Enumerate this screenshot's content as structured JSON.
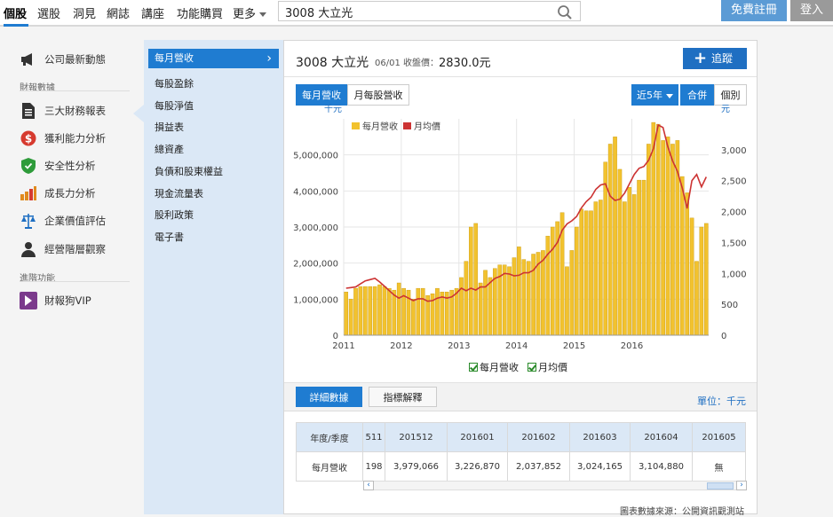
{
  "nav": {
    "items": [
      "個股",
      "選股",
      "洞見",
      "網誌",
      "講座",
      "功能購買",
      "更多"
    ],
    "search_value": "3008 大立光",
    "register": "免費註冊",
    "login": "登入"
  },
  "sidebar": {
    "top_item": "公司最新動態",
    "section1": "財報數據",
    "items": [
      "三大財務報表",
      "獲利能力分析",
      "安全性分析",
      "成長力分析",
      "企業價值評估",
      "經營階層觀察"
    ],
    "section2": "進階功能",
    "vip": "財報狗VIP"
  },
  "submenu": {
    "active": "每月營收",
    "items": [
      "每股盈餘",
      "每股淨值",
      "損益表",
      "總資產",
      "負債和股東權益",
      "現金流量表",
      "股利政策",
      "電子書"
    ]
  },
  "main": {
    "title": "3008 大立光",
    "date_label": "06/01 收盤價：",
    "price": "2830.0元",
    "track_button": "追蹤",
    "tab1": "每月營收",
    "tab2": "月每股營收",
    "range_button": "近5年",
    "merge_button": "合併",
    "single_button": "個別",
    "legend_check1": "每月營收",
    "legend_check2": "月均價",
    "detail_tab": "詳細數據",
    "indicator_tab": "指標解釋",
    "unit": "單位：千元",
    "source": "圖表數據來源：公開資訊觀測站"
  },
  "chart_data": {
    "type": "bar",
    "title": "",
    "y_left_unit": "千元",
    "y_right_unit": "元",
    "ylim_left": [
      0,
      6000000
    ],
    "ylim_right": [
      0,
      3500
    ],
    "y_left_ticks": [
      "0",
      "1,000,000",
      "2,000,000",
      "3,000,000",
      "4,000,000",
      "5,000,000"
    ],
    "y_right_ticks": [
      "0",
      "500",
      "1,000",
      "1,500",
      "2,000",
      "2,500",
      "3,000"
    ],
    "x_ticks": [
      "2011",
      "2012",
      "2013",
      "2014",
      "2015",
      "2016"
    ],
    "series": [
      {
        "name": "每月營收",
        "color": "#f2c22e",
        "start": "2011-01",
        "values": [
          1200000,
          1000000,
          1300000,
          1350000,
          1350000,
          1350000,
          1350000,
          1400000,
          1350000,
          1300000,
          1250000,
          1450000,
          1300000,
          1250000,
          1000000,
          1300000,
          1300000,
          1100000,
          1150000,
          1300000,
          1200000,
          1200000,
          1250000,
          1300000,
          1600000,
          2050000,
          3000000,
          3100000,
          1450000,
          1800000,
          1600000,
          1850000,
          1950000,
          1950000,
          1900000,
          2150000,
          2450000,
          2100000,
          2050000,
          2250000,
          2300000,
          2350000,
          2750000,
          3000000,
          3150000,
          3400000,
          1900000,
          2350000,
          3000000,
          3500000,
          3450000,
          3450000,
          3700000,
          3750000,
          4800000,
          5300000,
          5500000,
          4600000,
          3700000,
          4100000,
          3900000,
          4300000,
          4300000,
          5300000,
          5900000,
          5850000,
          5400000,
          5500000,
          5300000,
          5400000,
          4400000,
          3950000,
          3250000,
          2050000,
          3000000,
          3100000
        ],
        "values_note": ""
      },
      {
        "name": "月均價",
        "color": "#cc3333",
        "values": [
          760,
          770,
          780,
          830,
          880,
          900,
          920,
          860,
          790,
          720,
          650,
          600,
          640,
          600,
          560,
          590,
          590,
          550,
          560,
          600,
          620,
          600,
          620,
          680,
          760,
          720,
          760,
          730,
          780,
          780,
          850,
          920,
          950,
          1000,
          990,
          960,
          970,
          1010,
          1010,
          1050,
          1150,
          1210,
          1310,
          1390,
          1500,
          1700,
          1800,
          1850,
          1920,
          2060,
          2160,
          2230,
          2360,
          2430,
          2450,
          2250,
          2180,
          2200,
          2300,
          2450,
          2600,
          2700,
          2730,
          2830,
          3020,
          3400,
          3360,
          3050,
          2820,
          2650,
          2380,
          2050,
          2500,
          2600,
          2400,
          2560
        ]
      }
    ],
    "legend": [
      "每月營收",
      "月均價"
    ]
  },
  "table": {
    "header_label": "年度/季度",
    "row_label": "每月營收",
    "columns": [
      "511",
      "201512",
      "201601",
      "201602",
      "201603",
      "201604",
      "201605"
    ],
    "values": [
      "198",
      "3,979,066",
      "3,226,870",
      "2,037,852",
      "3,024,165",
      "3,104,880",
      "無"
    ]
  }
}
